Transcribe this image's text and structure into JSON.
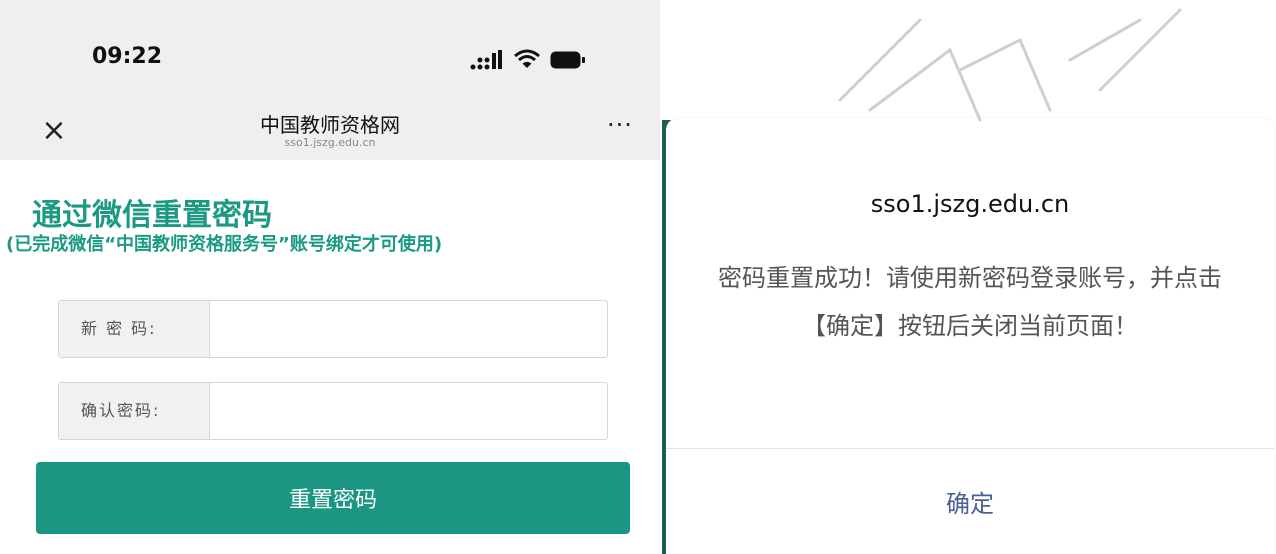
{
  "status_bar": {
    "time": "09:22",
    "icons": [
      "signal-icon",
      "wifi-icon",
      "battery-icon"
    ]
  },
  "nav": {
    "close_glyph": "×",
    "title": "中国教师资格网",
    "subtitle": "sso1.jszg.edu.cn",
    "more_glyph": "···"
  },
  "page": {
    "heading": "通过微信重置密码",
    "subheading": "(已完成微信“中国教师资格服务号”账号绑定才可使用)"
  },
  "form": {
    "new_password_label": "新 密 码:",
    "new_password_value": "",
    "confirm_password_label": "确认密码:",
    "confirm_password_value": "",
    "reset_button_label": "重置密码"
  },
  "dialog": {
    "title": "sso1.jszg.edu.cn",
    "message": "密码重置成功！请使用新密码登录账号，并点击【确定】按钮后关闭当前页面！",
    "confirm_label": "确定"
  },
  "colors": {
    "accent_green": "#1b9a82",
    "button_green": "#1a9683",
    "dialog_link": "#4a5f9a"
  }
}
